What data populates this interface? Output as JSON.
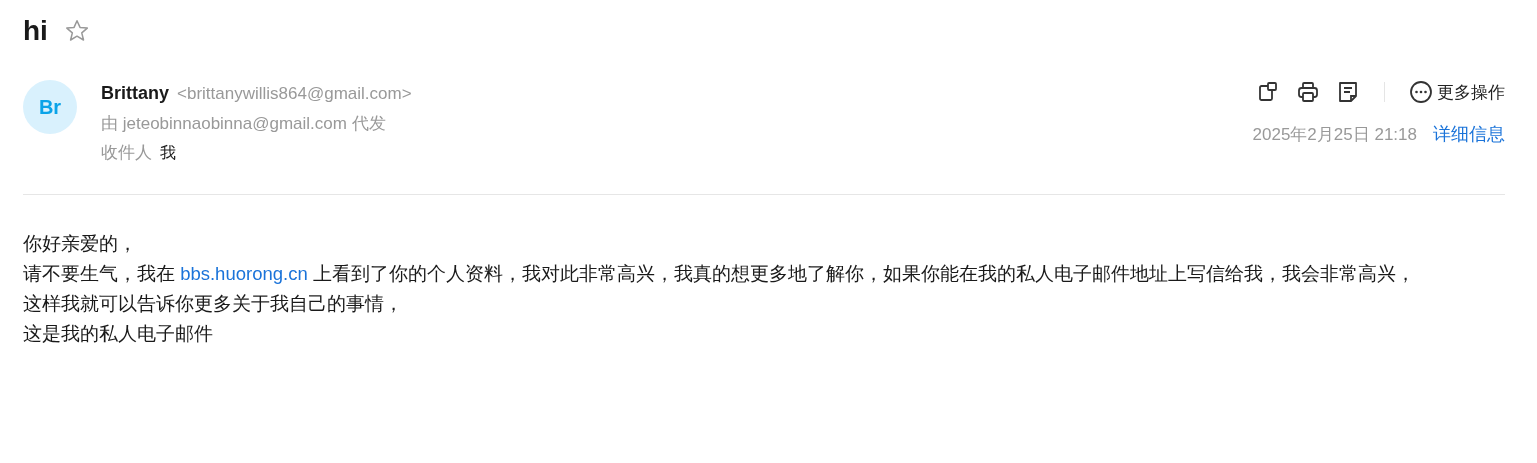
{
  "subject": "hi",
  "starred": false,
  "sender": {
    "avatar": "Br",
    "name": "Brittany",
    "address": "<brittanywillis864@gmail.com>",
    "sent_by": "由 jeteobinnaobinna@gmail.com 代发",
    "to_label": "收件人",
    "to": "我"
  },
  "toolbar": {
    "more": "更多操作",
    "date": "2025年2月25日 21:18",
    "details": "详细信息"
  },
  "body": [
    {
      "kind": "text",
      "text": "你好亲爱的，"
    },
    {
      "kind": "link_text",
      "before": "请不要生气，我在 ",
      "link": "bbs.huorong.cn",
      "after": " 上看到了你的个人资料，我对此非常高兴，我真的想更多地了解你，如果你能在我的私人电子邮件地址上写信给我，我会非常高兴，这样我就可以告诉你更多关于我自己的事情，"
    },
    {
      "kind": "text",
      "text": "这是我的私人电子邮件"
    }
  ]
}
